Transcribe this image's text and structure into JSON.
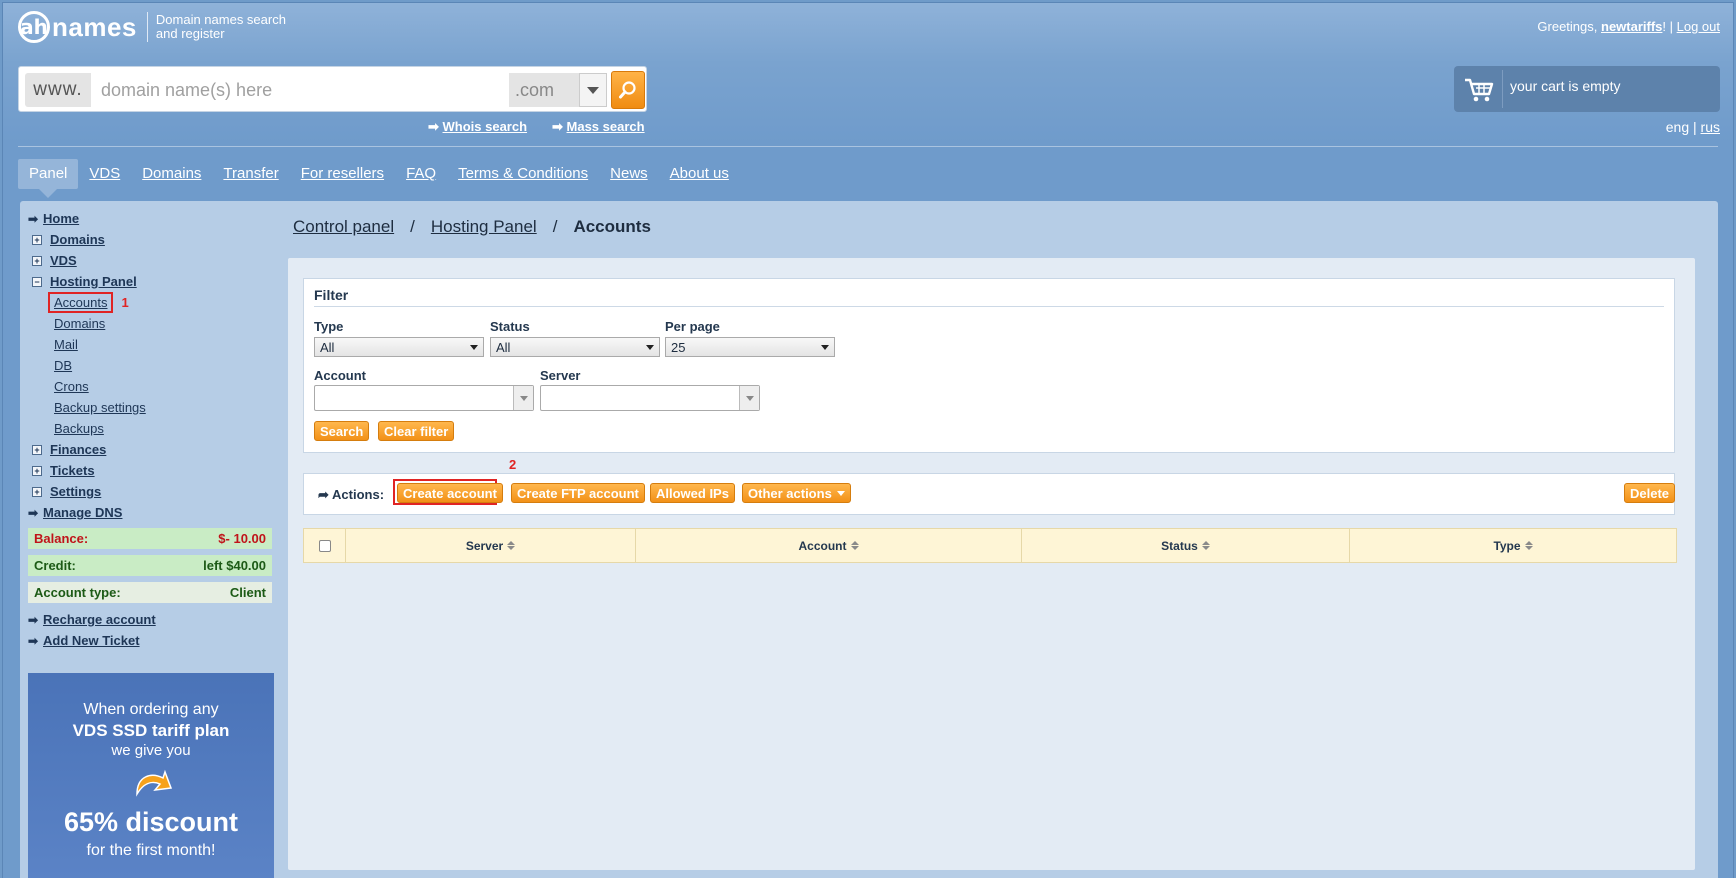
{
  "header": {
    "logo_mark": "ah",
    "logo_text": "names",
    "tagline_1": "Domain names search",
    "tagline_2": "and register",
    "greeting_prefix": "Greetings, ",
    "username": "newtariffs",
    "greeting_suffix": "! | ",
    "logout": "Log out"
  },
  "search": {
    "prefix": "www.",
    "placeholder": "domain name(s) here",
    "tld": ".com",
    "whois_link": "Whois search",
    "mass_link": "Mass search"
  },
  "cart": {
    "text": "your cart is empty"
  },
  "lang": {
    "eng": "eng",
    "sep": " | ",
    "rus": "rus"
  },
  "nav": {
    "items": [
      "Panel",
      "VDS",
      "Domains",
      "Transfer",
      "For resellers",
      "FAQ",
      "Terms & Conditions",
      "News",
      "About us"
    ],
    "active": "Panel"
  },
  "sidebar": {
    "home": "Home",
    "domains": "Domains",
    "vds": "VDS",
    "hosting_panel": "Hosting Panel",
    "sub": [
      "Accounts",
      "Domains",
      "Mail",
      "DB",
      "Crons",
      "Backup settings",
      "Backups"
    ],
    "mark1": "1",
    "finances": "Finances",
    "tickets": "Tickets",
    "settings": "Settings",
    "manage_dns": "Manage DNS",
    "balance_label": "Balance:",
    "balance_value": "$- 10.00",
    "credit_label": "Credit:",
    "credit_value": "left $40.00",
    "account_type_label": "Account type:",
    "account_type_value": "Client",
    "recharge": "Recharge account",
    "add_ticket": "Add New Ticket"
  },
  "promo": {
    "line1": "When ordering any",
    "line2": "VDS SSD tariff plan",
    "line3": "we give you",
    "line4": "65% discount",
    "line5": "for the first month!"
  },
  "breadcrumb": {
    "c1": "Control panel",
    "sep": "/",
    "c2": "Hosting Panel",
    "c3": "Accounts"
  },
  "filter": {
    "title": "Filter",
    "type_label": "Type",
    "type_value": "All",
    "status_label": "Status",
    "status_value": "All",
    "perpage_label": "Per page",
    "perpage_value": "25",
    "account_label": "Account",
    "server_label": "Server",
    "search_btn": "Search",
    "clear_btn": "Clear filter"
  },
  "actions": {
    "mark2": "2",
    "label": "Actions:",
    "create_account": "Create account",
    "create_ftp": "Create FTP account",
    "allowed_ips": "Allowed IPs",
    "other_actions": "Other actions",
    "delete": "Delete"
  },
  "table": {
    "columns": [
      "Server",
      "Account",
      "Status",
      "Type"
    ]
  },
  "colors": {
    "accent": "#f29117",
    "highlight": "#e02424",
    "header_bg": "#7aa3cf"
  }
}
